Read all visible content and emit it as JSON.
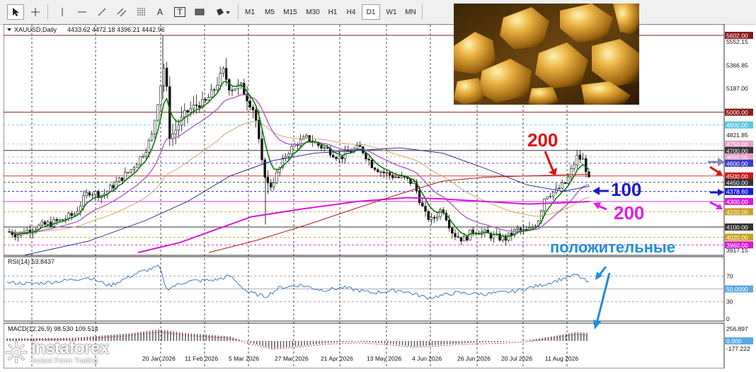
{
  "toolbar": {
    "timeframes": [
      "M1",
      "M5",
      "M15",
      "M30",
      "H1",
      "H4",
      "D1",
      "W1",
      "MN"
    ],
    "active_timeframe": "D1",
    "tool_icons": [
      "cursor-arrow-icon",
      "crosshair-icon",
      "vertical-line-icon",
      "horizontal-line-icon",
      "trendline-icon",
      "fibonacci-icon",
      "channel-icon",
      "text-icon",
      "text-label-icon",
      "rectangle-icon",
      "shapes-dropdown-icon"
    ],
    "text_tool_label": "A",
    "label_tool_label": "T"
  },
  "chart_header": {
    "symbol": "XAUUSD,Daily",
    "ohlc": "4433.62 4472.18 4396.21 4442.96"
  },
  "price_axis": {
    "ticks": [
      "5552.15",
      "5366.85",
      "5187.00",
      "4821.85",
      "3917.15"
    ],
    "labels": [
      {
        "text": "5602.00",
        "bg": "#8b1a1a"
      },
      {
        "text": "5000.00",
        "bg": "#8b1a1a"
      },
      {
        "text": "4900.00",
        "bg": "#5bc8e0"
      },
      {
        "text": "4750.00",
        "bg": "#e8a0c8"
      },
      {
        "text": "4700.00",
        "bg": "#333333"
      },
      {
        "text": "4650.00",
        "bg": "#e8a0c8"
      },
      {
        "text": "4600.00",
        "bg": "#3a3acc"
      },
      {
        "text": "4500.00",
        "bg": "#cc1a1a"
      },
      {
        "text": "4450.00",
        "bg": "#333333"
      },
      {
        "text": "4378.60",
        "bg": "#1a1acc"
      },
      {
        "text": "4300.00",
        "bg": "#d61ad6"
      },
      {
        "text": "4220.00",
        "bg": "#c8a020"
      },
      {
        "text": "4100.00",
        "bg": "#333333"
      },
      {
        "text": "4020.00",
        "bg": "#c8a020"
      },
      {
        "text": "3960.00",
        "bg": "#d61ad6"
      }
    ]
  },
  "time_axis": [
    "20 Jan 2026",
    "11 Feb 2026",
    "5 Mar 2026",
    "27 Mar 2026",
    "21 Apr 2026",
    "13 May 2026",
    "4 Jun 2026",
    "26 Jun 2026",
    "20 Jul 2026",
    "11 Aug 2026"
  ],
  "annotations": {
    "ma200_top": "200",
    "ma100": "100",
    "ma200_bottom": "200",
    "positive_text": "положительные"
  },
  "rsi": {
    "label": "RSI(14) 53.8437",
    "ticks": [
      "70",
      "30",
      "0"
    ],
    "value_badge": "50.0000"
  },
  "macd": {
    "label": "MACD(12,26,9) 98.530 109.514",
    "ticks": [
      "256.897",
      "-177.222"
    ],
    "value_badge": "0.000"
  },
  "watermark": {
    "brand": "instaforex",
    "tagline": "Instant Forex Trading"
  },
  "colors": {
    "ma_fast": "#0a7a0a",
    "ma_violet": "#b060c8",
    "ma_100": "#1a1a8c",
    "ma_200_red": "#b01a1a",
    "ma_magenta": "#d61ad6",
    "ma_tan": "#c8a060",
    "rsi_line": "#2a6fb8",
    "annotation_red": "#e01010",
    "annotation_blue": "#1a1acc",
    "annotation_magenta": "#e020e0",
    "annotation_cyan": "#1f8fd8"
  }
}
